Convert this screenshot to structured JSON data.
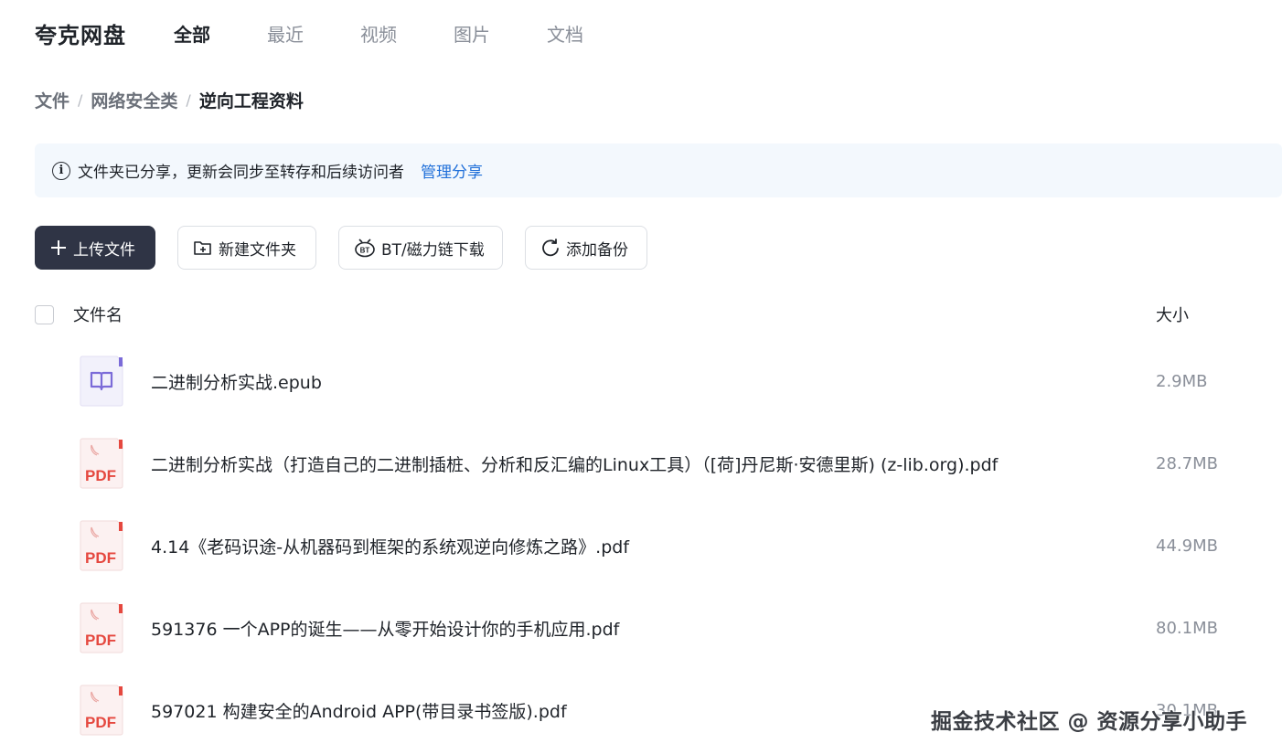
{
  "app": {
    "logo": "夸克网盘"
  },
  "nav": {
    "tabs": [
      {
        "label": "全部",
        "active": true
      },
      {
        "label": "最近",
        "active": false
      },
      {
        "label": "视频",
        "active": false
      },
      {
        "label": "图片",
        "active": false
      },
      {
        "label": "文档",
        "active": false
      }
    ]
  },
  "breadcrumb": {
    "items": [
      "文件",
      "网络安全类",
      "逆向工程资料"
    ],
    "separator": "/"
  },
  "notice": {
    "text": "文件夹已分享，更新会同步至转存和后续访问者",
    "link": "管理分享",
    "icon": "info-icon"
  },
  "toolbar": {
    "upload": "上传文件",
    "new_folder": "新建文件夹",
    "bt_download": "BT/磁力链下载",
    "add_backup": "添加备份"
  },
  "table": {
    "columns": {
      "name": "文件名",
      "size": "大小"
    },
    "files": [
      {
        "name": "二进制分析实战.epub",
        "size": "2.9MB",
        "type": "epub"
      },
      {
        "name": "二进制分析实战（打造自己的二进制插桩、分析和反汇编的Linux工具）（[荷]丹尼斯·安德里斯) (z-lib.org).pdf",
        "size": "28.7MB",
        "type": "pdf"
      },
      {
        "name": "4.14《老码识途-从机器码到框架的系统观逆向修炼之路》.pdf",
        "size": "44.9MB",
        "type": "pdf"
      },
      {
        "name": "591376 一个APP的诞生——从零开始设计你的手机应用.pdf",
        "size": "80.1MB",
        "type": "pdf"
      },
      {
        "name": "597021 构建安全的Android APP(带目录书签版).pdf",
        "size": "30.1MB",
        "type": "pdf"
      }
    ],
    "pdf_icon_label": "PDF"
  },
  "watermark": "掘金技术社区 @ 资源分享小助手",
  "colors": {
    "primary_button": "#2f3445",
    "link": "#1f6fd9",
    "notice_bg": "#f3f8fd",
    "pdf_red": "#e5483f",
    "epub_purple": "#7b6bd8"
  }
}
